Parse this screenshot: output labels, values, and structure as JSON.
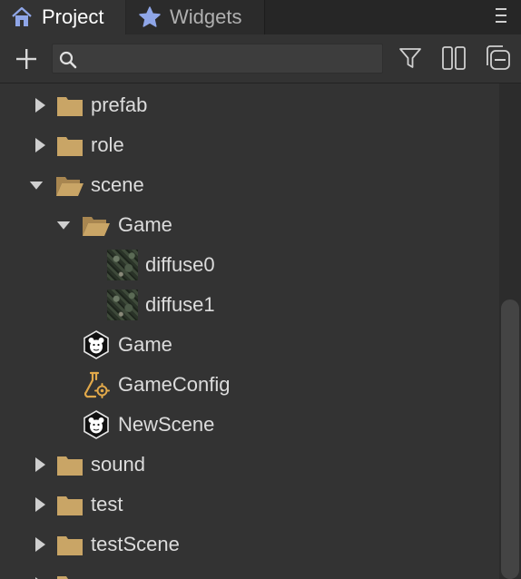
{
  "tabs": [
    {
      "label": "Project",
      "icon": "home-icon",
      "active": true
    },
    {
      "label": "Widgets",
      "icon": "star-icon",
      "active": false
    }
  ],
  "toolbar": {
    "add_icon": "plus-icon",
    "search_value": "",
    "search_placeholder": "",
    "filter_icon": "filter-icon",
    "columns_icon": "columns-icon",
    "collapse_icon": "collapse-all-icon"
  },
  "tree": [
    {
      "label": "prefab",
      "type": "folder",
      "state": "collapsed"
    },
    {
      "label": "role",
      "type": "folder",
      "state": "collapsed"
    },
    {
      "label": "scene",
      "type": "folder",
      "state": "expanded"
    },
    {
      "label": "Game",
      "type": "folder",
      "state": "expanded"
    },
    {
      "label": "diffuse0",
      "type": "texture"
    },
    {
      "label": "diffuse1",
      "type": "texture"
    },
    {
      "label": "Game",
      "type": "scene"
    },
    {
      "label": "GameConfig",
      "type": "config"
    },
    {
      "label": "NewScene",
      "type": "scene"
    },
    {
      "label": "sound",
      "type": "folder",
      "state": "collapsed"
    },
    {
      "label": "test",
      "type": "folder",
      "state": "collapsed"
    },
    {
      "label": "testScene",
      "type": "folder",
      "state": "collapsed"
    }
  ],
  "colors": {
    "background": "#333333",
    "tab_bar": "#262626",
    "folder": "#c9a566",
    "text": "#dcdcdc"
  }
}
